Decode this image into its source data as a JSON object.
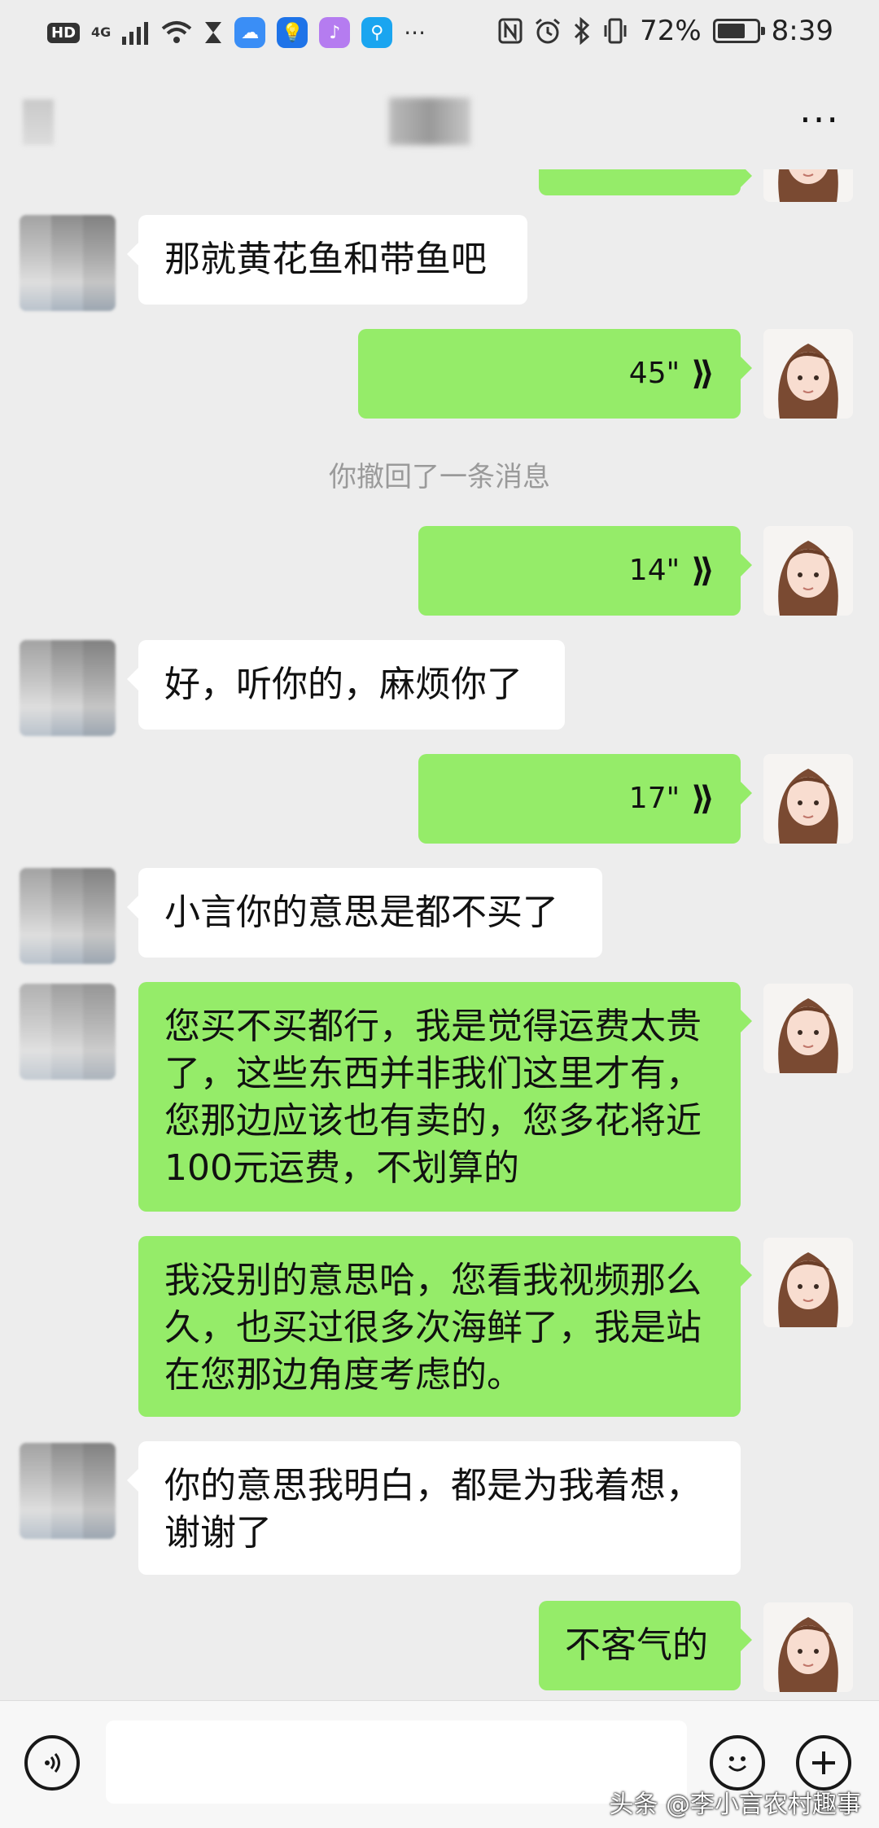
{
  "status_bar": {
    "hd": "HD",
    "network": "4G",
    "more": "···",
    "battery_percent": "72%",
    "battery_level": 0.72,
    "time": "8:39"
  },
  "header": {
    "more_label": "···"
  },
  "messages": [
    {
      "text": "那就黄花鱼和带鱼吧"
    },
    {
      "duration": "45\""
    },
    {
      "system": "你撤回了一条消息"
    },
    {
      "duration": "14\""
    },
    {
      "text": "好，听你的，麻烦你了"
    },
    {
      "duration": "17\""
    },
    {
      "text": "小言你的意思是都不买了"
    },
    {
      "text": "您买不买都行，我是觉得运费太贵了，这些东西并非我们这里才有，您那边应该也有卖的，您多花将近100元运费，不划算的"
    },
    {
      "text": "我没别的意思哈，您看我视频那么久，也买过很多次海鲜了，我是站在您那边角度考虑的。"
    },
    {
      "text": "你的意思我明白，都是为我着想，谢谢了"
    },
    {
      "text": "不客气的"
    }
  ],
  "input_bar": {
    "voice_icon": "voice-icon",
    "emoji_icon": "emoji-icon",
    "plus_icon": "plus-icon"
  },
  "watermark": "头条 @李小言农村趣事"
}
